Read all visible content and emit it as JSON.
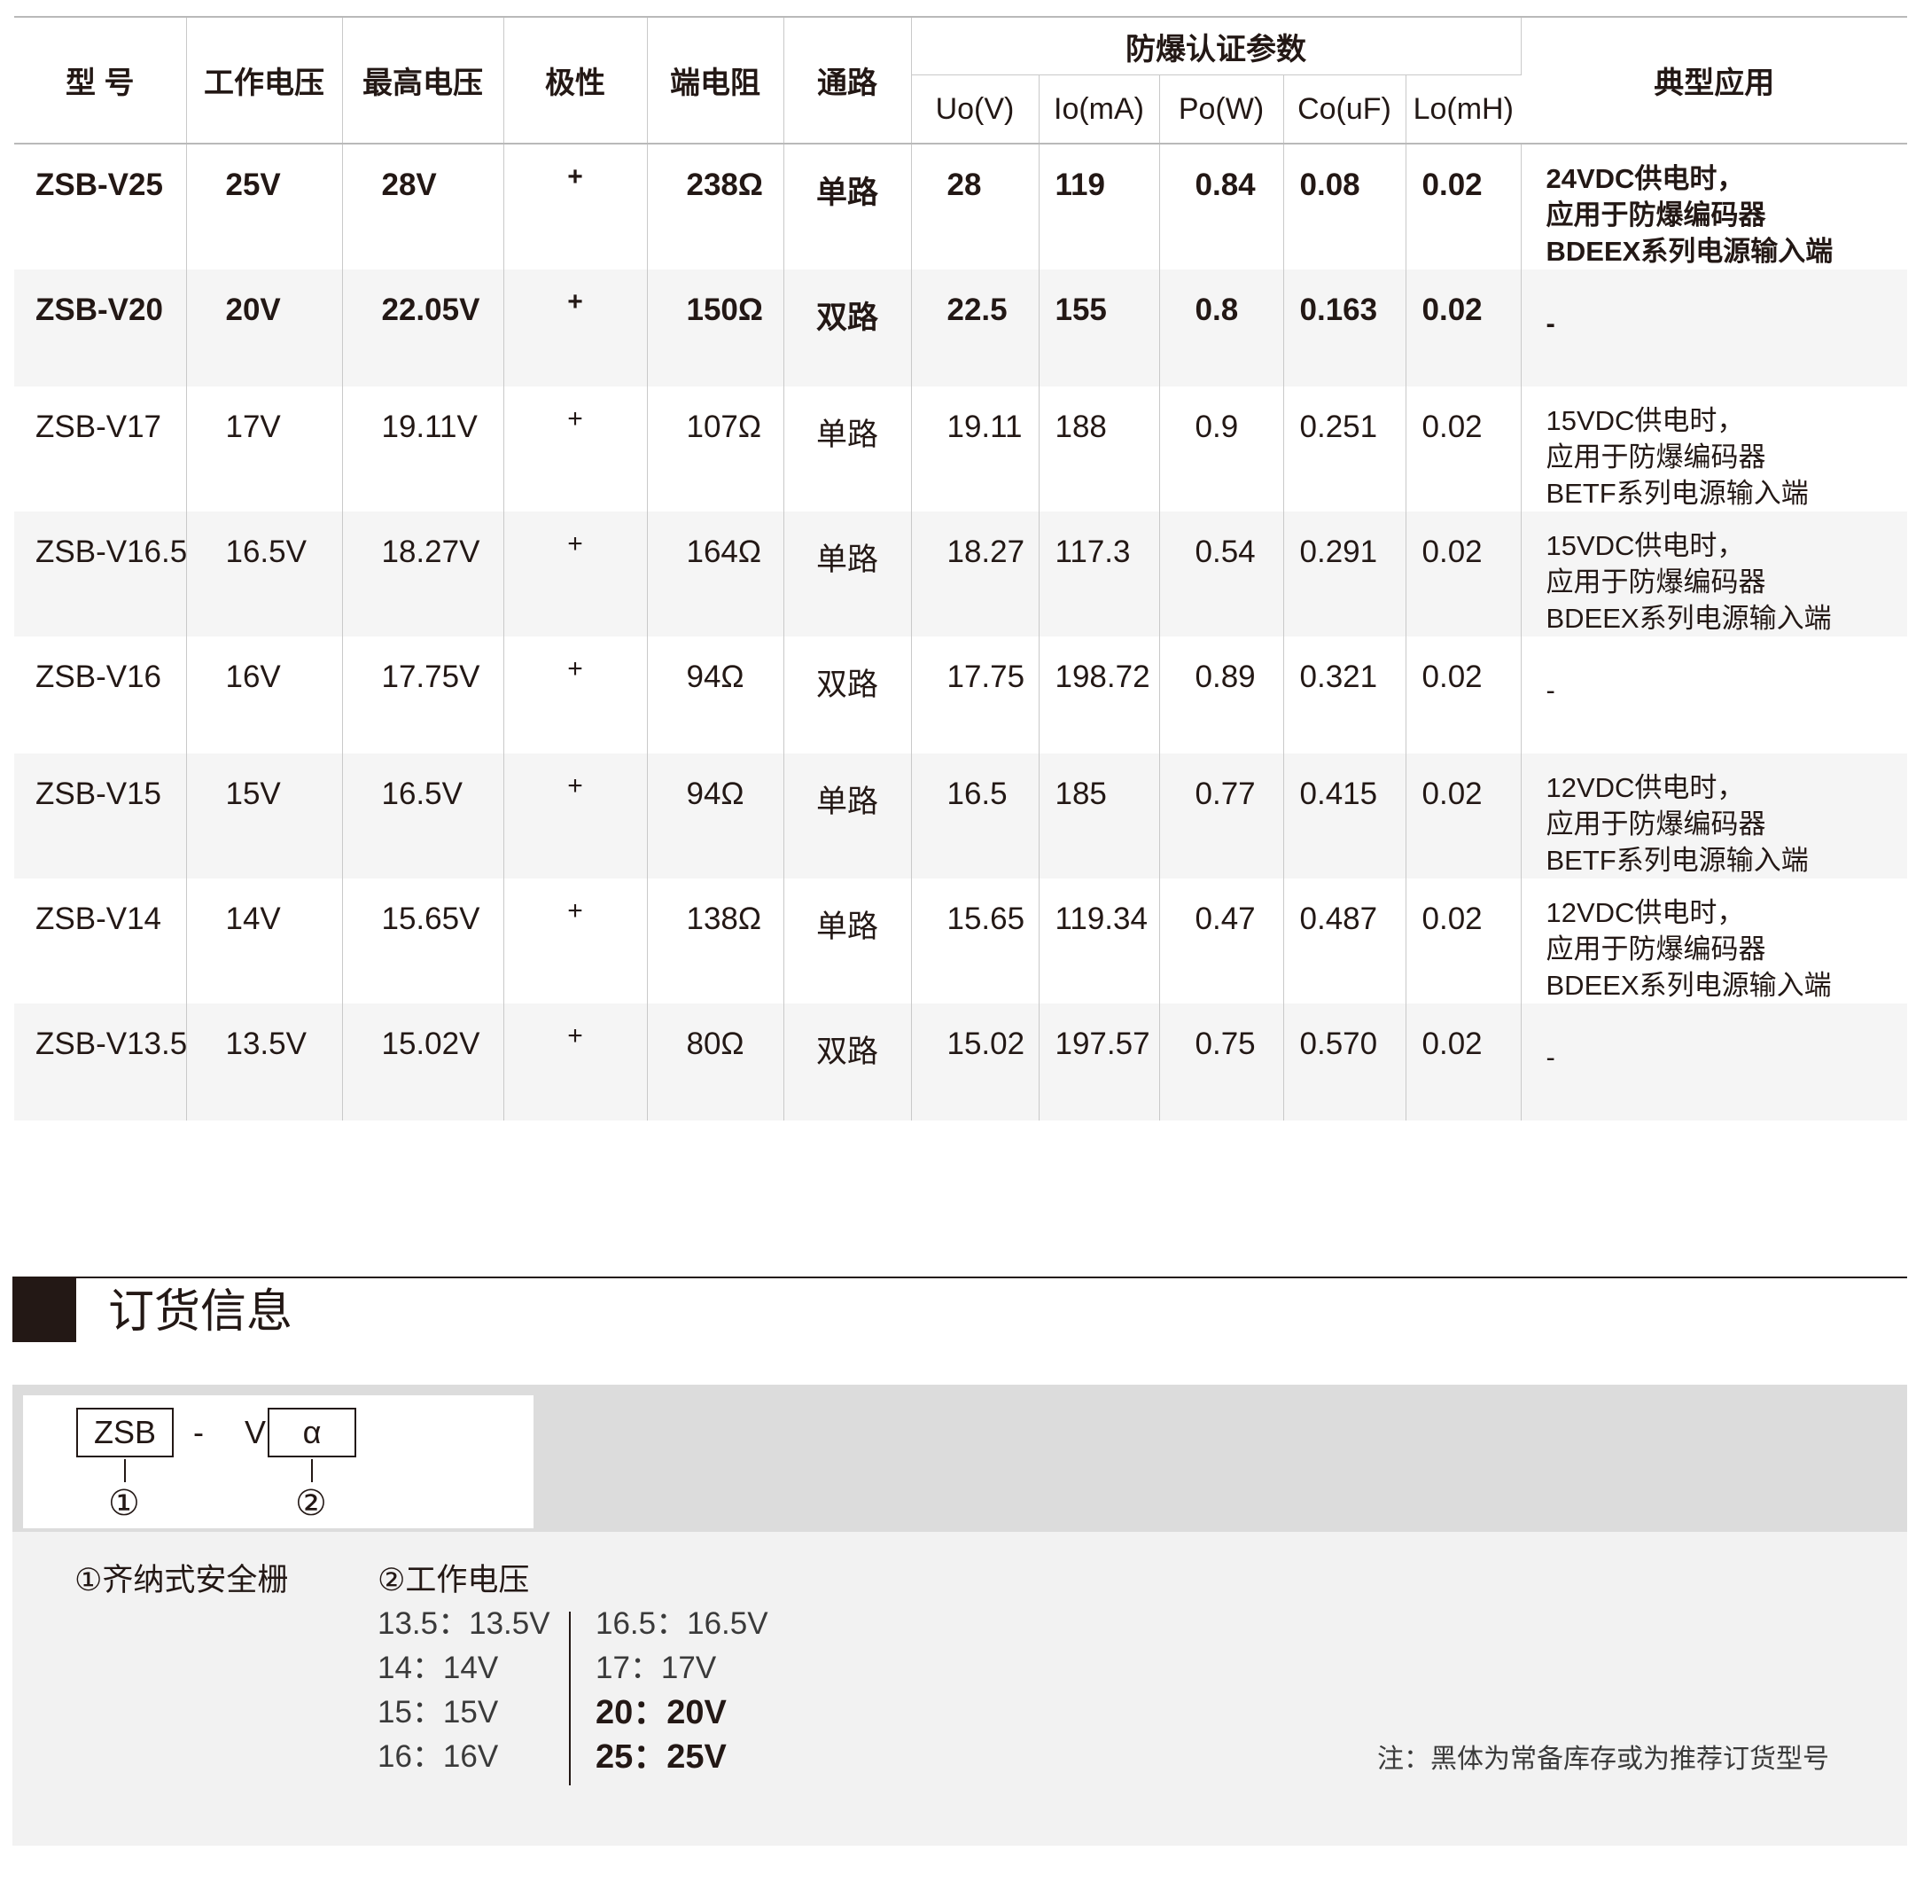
{
  "table": {
    "headers": {
      "model": "型 号",
      "voltage": "工作电压",
      "max_voltage": "最高电压",
      "polarity": "极性",
      "resistance": "端电阻",
      "channel": "通路",
      "ex_group": "防爆认证参数",
      "uo": "Uo(V)",
      "io": "Io(mA)",
      "po": "Po(W)",
      "co": "Co(uF)",
      "lo": "Lo(mH)",
      "application": "典型应用"
    },
    "rows": [
      {
        "model": "ZSB-V25",
        "voltage": "25V",
        "max_voltage": "28V",
        "polarity": "+",
        "resistance": "238Ω",
        "channel": "单路",
        "uo": "28",
        "io": "119",
        "po": "0.84",
        "co": "0.08",
        "lo": "0.02",
        "app": [
          "24VDC供电时，",
          "应用于防爆编码器",
          "BDEEX系列电源输入端"
        ]
      },
      {
        "model": "ZSB-V20",
        "voltage": "20V",
        "max_voltage": "22.05V",
        "polarity": "+",
        "resistance": "150Ω",
        "channel": "双路",
        "uo": "22.5",
        "io": "155",
        "po": "0.8",
        "co": "0.163",
        "lo": "0.02",
        "app": [
          "-"
        ]
      },
      {
        "model": "ZSB-V17",
        "voltage": "17V",
        "max_voltage": "19.11V",
        "polarity": "+",
        "resistance": "107Ω",
        "channel": "单路",
        "uo": "19.11",
        "io": "188",
        "po": "0.9",
        "co": "0.251",
        "lo": "0.02",
        "app": [
          "15VDC供电时，",
          "应用于防爆编码器",
          "BETF系列电源输入端"
        ]
      },
      {
        "model": "ZSB-V16.5",
        "voltage": "16.5V",
        "max_voltage": "18.27V",
        "polarity": "+",
        "resistance": "164Ω",
        "channel": "单路",
        "uo": "18.27",
        "io": "117.3",
        "po": "0.54",
        "co": "0.291",
        "lo": "0.02",
        "app": [
          "15VDC供电时，",
          "应用于防爆编码器",
          "BDEEX系列电源输入端"
        ]
      },
      {
        "model": "ZSB-V16",
        "voltage": "16V",
        "max_voltage": "17.75V",
        "polarity": "+",
        "resistance": "94Ω",
        "channel": "双路",
        "uo": "17.75",
        "io": "198.72",
        "po": "0.89",
        "co": "0.321",
        "lo": "0.02",
        "app": [
          "-"
        ]
      },
      {
        "model": "ZSB-V15",
        "voltage": "15V",
        "max_voltage": "16.5V",
        "polarity": "+",
        "resistance": "94Ω",
        "channel": "单路",
        "uo": "16.5",
        "io": "185",
        "po": "0.77",
        "co": "0.415",
        "lo": "0.02",
        "app": [
          "12VDC供电时，",
          "应用于防爆编码器",
          "BETF系列电源输入端"
        ]
      },
      {
        "model": "ZSB-V14",
        "voltage": "14V",
        "max_voltage": "15.65V",
        "polarity": "+",
        "resistance": "138Ω",
        "channel": "单路",
        "uo": "15.65",
        "io": "119.34",
        "po": "0.47",
        "co": "0.487",
        "lo": "0.02",
        "app": [
          "12VDC供电时，",
          "应用于防爆编码器",
          "BDEEX系列电源输入端"
        ]
      },
      {
        "model": "ZSB-V13.5",
        "voltage": "13.5V",
        "max_voltage": "15.02V",
        "polarity": "+",
        "resistance": "80Ω",
        "channel": "双路",
        "uo": "15.02",
        "io": "197.57",
        "po": "0.75",
        "co": "0.570",
        "lo": "0.02",
        "app": [
          "-"
        ]
      }
    ]
  },
  "order": {
    "title": "订货信息",
    "code_box1": "ZSB",
    "code_sep": "- V",
    "code_box2": "α",
    "mark1": "①",
    "mark2": "②",
    "label1": "①齐纳式安全栅",
    "label2": "②工作电压",
    "voltages_left": [
      "13.5：13.5V",
      "14：14V",
      "15：15V",
      "16：16V"
    ],
    "voltages_right": [
      "16.5：16.5V",
      "17：17V",
      "20：20V",
      "25：25V"
    ],
    "note": "注：黑体为常备库存或为推荐订货型号"
  }
}
